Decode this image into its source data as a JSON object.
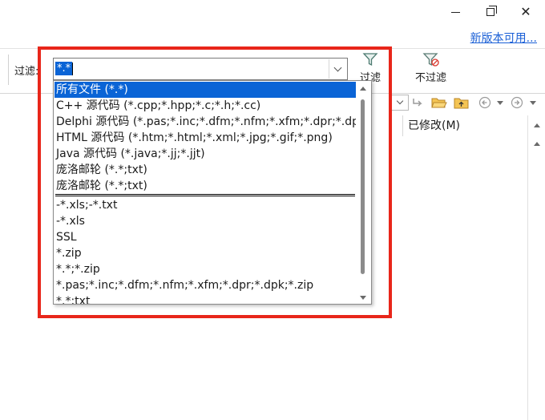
{
  "window": {
    "minimize_icon": "minimize-icon",
    "maximize_icon": "restore-icon",
    "close_icon": "close-icon",
    "close_glyph": "✕"
  },
  "header": {
    "update_link": "新版本可用..."
  },
  "toolbar": {
    "filter_label": "过滤:",
    "filter_value": "*.*",
    "filter_button_label": "过滤",
    "no_filter_button_label": "不过滤"
  },
  "file_list": {
    "modified_column": "已修改(M)"
  },
  "dropdown": {
    "items": [
      "所有文件 (*.*)",
      "C++ 源代码 (*.cpp;*.hpp;*.c;*.h;*.cc)",
      "Delphi 源代码 (*.pas;*.inc;*.dfm;*.nfm;*.xfm;*.dpr;*.dpk)",
      "HTML 源代码 (*.htm;*.html;*.xml;*.jpg;*.gif;*.png)",
      "Java 源代码 (*.java;*.jj;*.jjt)",
      "庞洛邮轮 (*.*;txt)",
      "庞洛邮轮 (*.*;txt)"
    ],
    "history": [
      "-*.xls;-*.txt",
      "-*.xls",
      "SSL",
      "*.zip",
      "*.*;*.zip",
      "*.pas;*.inc;*.dfm;*.nfm;*.xfm;*.dpr;*.dpk;*.zip",
      "*.*;txt"
    ]
  },
  "colors": {
    "highlight": "#e8261a",
    "selection": "#0a64d6",
    "link": "#1a5fd6"
  }
}
